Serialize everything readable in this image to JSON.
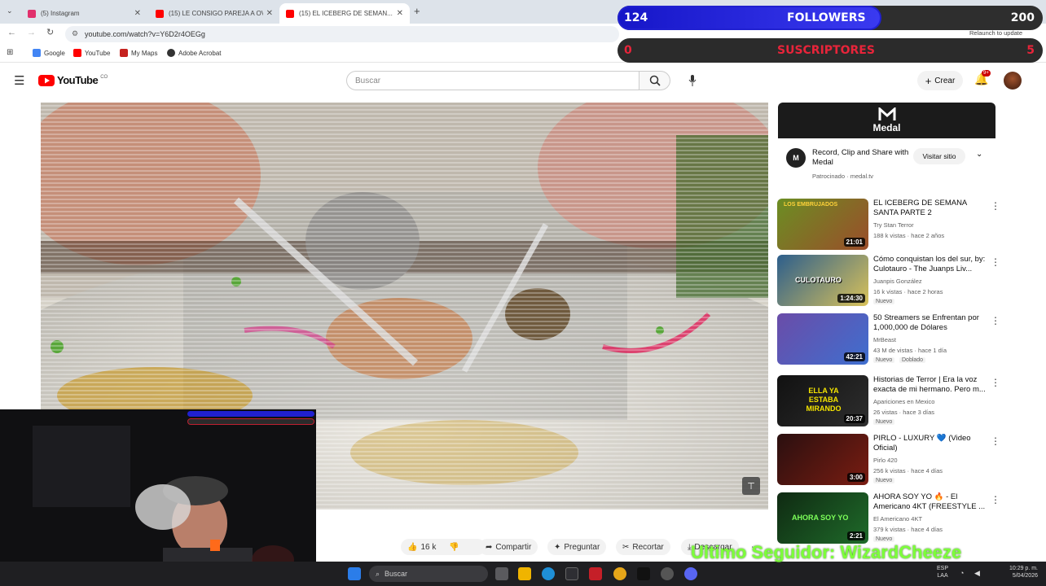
{
  "browser": {
    "tabs": [
      {
        "title": "(5) Instagram",
        "color": "#e1306c"
      },
      {
        "title": "(15) LE CONSIGO PAREJA A OV...",
        "color": "#ff0000"
      },
      {
        "title": "(15) EL ICEBERG DE SEMAN...",
        "color": "#ff0000"
      }
    ],
    "url": "youtube.com/watch?v=Y6D2r4OEGg",
    "relaunch": "Relaunch to update",
    "bookmarks": [
      {
        "label": "Google",
        "color": "#4285f4"
      },
      {
        "label": "YouTube",
        "color": "#ff0000"
      },
      {
        "label": "My Maps",
        "color": "#c5221f"
      },
      {
        "label": "Adobe Acrobat",
        "color": "#333333"
      }
    ]
  },
  "overlay": {
    "followers_count": "124",
    "followers_label": "FOLLOWERS",
    "followers_goal": "200",
    "followers_progress": 0.62,
    "subs_count": "0",
    "subs_label": "SUSCRIPTORES",
    "subs_goal": "5",
    "last_follower": "Ultimo Seguidor: WizardCheeze"
  },
  "youtube": {
    "logo": "YouTube",
    "region": "CO",
    "search_placeholder": "Buscar",
    "create_label": "Crear",
    "notif_badge": "9+"
  },
  "ad": {
    "brand": "Medal",
    "title": "Record, Clip and Share with Medal",
    "sponsored": "Patrocinado · medal.tv",
    "visit_label": "Visitar sitio"
  },
  "sidebar": [
    {
      "title": "EL ICEBERG DE SEMANA SANTA PARTE 2",
      "channel": "Try Stan Terror",
      "meta": "188 k vistas · hace 2 años",
      "duration": "21:01",
      "badge": "",
      "thumb": "#6b8e23",
      "thumb2": "#9b4d2a"
    },
    {
      "title": "Cómo conquistan los del sur, by: Culotauro - The Juanps Liv...",
      "channel": "Juanpis González",
      "meta": "16 k vistas · hace 2 horas",
      "duration": "1:24:30",
      "badge": "Nuevo",
      "thumb": "#2c5e8c",
      "thumb2": "#d9c25a"
    },
    {
      "title": "50 Streamers se Enfrentan por 1,000,000 de Dólares",
      "channel": "MrBeast",
      "meta": "43 M de vistas · hace 1 día",
      "duration": "42:21",
      "badge": "Nuevo",
      "badge2": "Doblado",
      "thumb": "#6a4ca8",
      "thumb2": "#3f6fcf"
    },
    {
      "title": "Historias de Terror | Era la voz exacta de mi hermano. Pero m...",
      "channel": "Apariciones en Mexico",
      "meta": "26 vistas · hace 3 días",
      "duration": "20:37",
      "badge": "Nuevo",
      "thumb": "#111111",
      "thumb2": "#2e2e2e"
    },
    {
      "title": "PIRLO - LUXURY 💙 (Video Oficial)",
      "channel": "Pirlo 420",
      "meta": "256 k vistas · hace 4 días",
      "duration": "3:00",
      "badge": "Nuevo",
      "thumb": "#2a0f0f",
      "thumb2": "#7a1d12"
    },
    {
      "title": "AHORA SOY YO 🔥 - El Americano 4KT (FREESTYLE ...",
      "channel": "El Americano 4KT",
      "meta": "379 k vistas · hace 4 días",
      "duration": "2:21",
      "badge": "Nuevo",
      "thumb": "#0f2a12",
      "thumb2": "#1f6b2a"
    }
  ],
  "thumb_texts": {
    "iceberg": "LOS EMBRUJADOS",
    "culo": "CULOTAURO",
    "terror": "ELLA YA ESTABA MIRANDO",
    "americano": "AHORA SOY YO"
  },
  "actions": {
    "likes": "16 k",
    "share": "Compartir",
    "ask": "Preguntar",
    "clip": "Recortar",
    "download": "Descargar"
  },
  "taskbar": {
    "search": "Buscar",
    "lang": "ESP",
    "lang2": "LAA",
    "time": "10:29 p. m.",
    "date": "5/04/2026"
  }
}
